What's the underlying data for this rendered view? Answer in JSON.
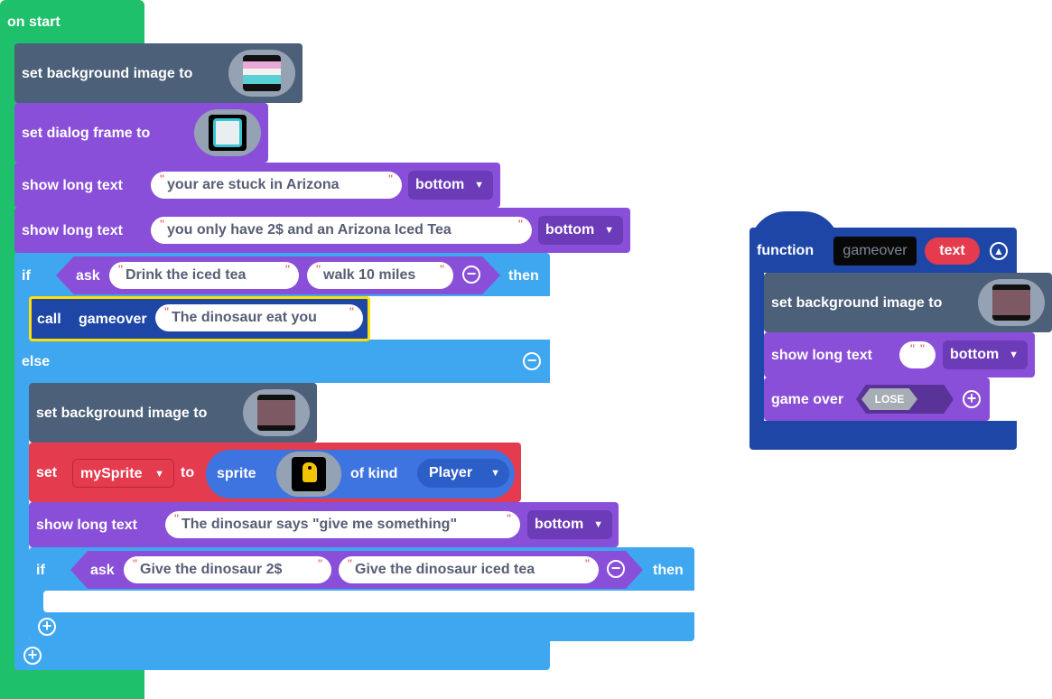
{
  "on_start": {
    "hat_label": "on start",
    "set_bg_label": "set background image to",
    "set_dialog_label": "set dialog frame to",
    "show_long_text_1": {
      "label": "show long text",
      "text": "your are stuck in Arizona",
      "position": "bottom"
    },
    "show_long_text_2": {
      "label": "show long text",
      "text": "you only have 2$ and an Arizona Iced Tea",
      "position": "bottom"
    },
    "if_1": {
      "if_label": "if",
      "ask_label": "ask",
      "option_a": "Drink the iced tea",
      "option_b": "walk 10 miles",
      "then_label": "then",
      "call": {
        "call_label": "call",
        "function_name": "gameover",
        "arg": "The dinosaur eat you"
      },
      "else_label": "else",
      "else_body": {
        "set_bg_label": "set background image to",
        "set_sprite": {
          "set_label": "set",
          "variable": "mySprite",
          "to_label": "to",
          "sprite_label": "sprite",
          "of_kind_label": "of kind",
          "kind": "Player"
        },
        "show_long_text": {
          "label": "show long text",
          "text": "The dinosaur says \"give me something\"",
          "position": "bottom"
        },
        "if_2": {
          "if_label": "if",
          "ask_label": "ask",
          "option_a": "Give the dinosaur 2$",
          "option_b": "Give the dinosaur iced tea",
          "then_label": "then"
        }
      }
    }
  },
  "function_def": {
    "function_label": "function",
    "name": "gameover",
    "param": "text",
    "set_bg_label": "set background image to",
    "show_long_text": {
      "label": "show long text",
      "text": "",
      "position": "bottom"
    },
    "game_over": {
      "label": "game over",
      "result": "LOSE"
    }
  },
  "icons": [
    "minus-icon",
    "plus-icon",
    "dropdown-arrow-icon",
    "collapse-up-icon",
    "image-thumbnail-icon",
    "dinosaur-sprite-icon"
  ],
  "colors": {
    "events_green": "#1fc06b",
    "scene_slate": "#4c6079",
    "game_purple": "#8a4fd8",
    "logic_blue": "#3fa7f0",
    "functions_navy": "#1d46a7",
    "sprites_red": "#e43b4f",
    "selected_yellow": "#ffe000"
  }
}
